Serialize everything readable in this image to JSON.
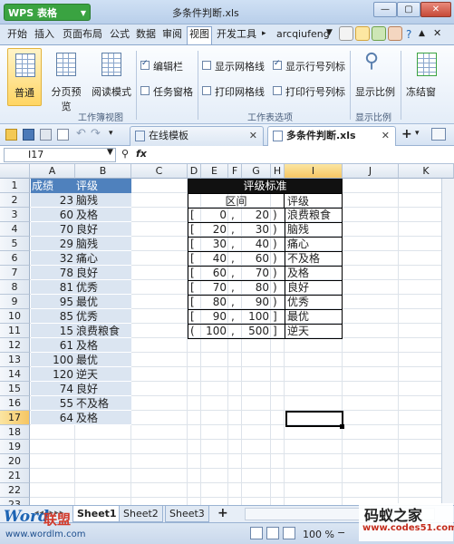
{
  "window": {
    "app_name": "WPS 表格",
    "title": "多条件判断.xls"
  },
  "menu": {
    "tabs": [
      "开始",
      "插入",
      "页面布局",
      "公式",
      "数据",
      "审阅",
      "视图",
      "开发工具"
    ],
    "active_tab": "视图",
    "user": "arcqiufeng"
  },
  "ribbon": {
    "workbook_views": {
      "normal": "普通",
      "page_break_preview": "分页预览",
      "reading_mode": "阅读模式",
      "group_label": "工作簿视图"
    },
    "checkboxes": [
      {
        "label": "编辑栏",
        "checked": true
      },
      {
        "label": "任务窗格",
        "checked": false
      },
      {
        "label": "显示网格线",
        "checked": false
      },
      {
        "label": "打印网格线",
        "checked": false
      },
      {
        "label": "显示行号列标",
        "checked": true
      },
      {
        "label": "打印行号列标",
        "checked": false
      }
    ],
    "sheet_options_label": "工作表选项",
    "zoom_label": "显示比例",
    "zoom_group_label": "显示比例",
    "freeze_label": "冻结窗"
  },
  "doc_tabs": {
    "online_templates": "在线模板",
    "current": "多条件判断.xls"
  },
  "formula_bar": {
    "name_box": "I17",
    "fx": "fx",
    "content": ""
  },
  "grid": {
    "columns": [
      "A",
      "B",
      "C",
      "D",
      "E",
      "F",
      "G",
      "H",
      "I",
      "J",
      "K"
    ],
    "selected_column": "I",
    "rows": [
      "1",
      "2",
      "3",
      "4",
      "5",
      "6",
      "7",
      "8",
      "9",
      "10",
      "11",
      "12",
      "13",
      "14",
      "15",
      "16",
      "17",
      "18",
      "19",
      "20",
      "21",
      "22",
      "23"
    ],
    "selected_row": "17",
    "left_table": {
      "header": [
        "成绩",
        "评级"
      ],
      "rows": [
        [
          "23",
          "脑残"
        ],
        [
          "60",
          "及格"
        ],
        [
          "70",
          "良好"
        ],
        [
          "29",
          "脑残"
        ],
        [
          "32",
          "痛心"
        ],
        [
          "78",
          "良好"
        ],
        [
          "81",
          "优秀"
        ],
        [
          "95",
          "最优"
        ],
        [
          "85",
          "优秀"
        ],
        [
          "15",
          "浪费粮食"
        ],
        [
          "61",
          "及格"
        ],
        [
          "100",
          "最优"
        ],
        [
          "120",
          "逆天"
        ],
        [
          "74",
          "良好"
        ],
        [
          "55",
          "不及格"
        ],
        [
          "64",
          "及格"
        ]
      ]
    },
    "right_table": {
      "title": "评级标准",
      "header_range": "区间",
      "header_grade": "评级",
      "rows": [
        {
          "open": "[",
          "low": "0",
          "sep": ",",
          "high": "20",
          "close": ")",
          "grade": "浪费粮食"
        },
        {
          "open": "[",
          "low": "20",
          "sep": ",",
          "high": "30",
          "close": ")",
          "grade": "脑残"
        },
        {
          "open": "[",
          "low": "30",
          "sep": ",",
          "high": "40",
          "close": ")",
          "grade": "痛心"
        },
        {
          "open": "[",
          "low": "40",
          "sep": ",",
          "high": "60",
          "close": ")",
          "grade": "不及格"
        },
        {
          "open": "[",
          "low": "60",
          "sep": ",",
          "high": "70",
          "close": ")",
          "grade": "及格"
        },
        {
          "open": "[",
          "low": "70",
          "sep": ",",
          "high": "80",
          "close": ")",
          "grade": "良好"
        },
        {
          "open": "[",
          "low": "80",
          "sep": ",",
          "high": "90",
          "close": ")",
          "grade": "优秀"
        },
        {
          "open": "[",
          "low": "90",
          "sep": ",",
          "high": "100",
          "close": "]",
          "grade": "最优"
        },
        {
          "open": "(",
          "low": "100",
          "sep": ",",
          "high": "500",
          "close": "]",
          "grade": "逆天"
        }
      ]
    }
  },
  "sheets": [
    "Sheet1",
    "Sheet2",
    "Sheet3"
  ],
  "active_sheet": "Sheet1",
  "status": {
    "zoom": "100 %"
  },
  "watermarks": {
    "left_word": "Word",
    "left_cn": "联盟",
    "left_url": "www.wordlm.com",
    "right_cn": "码蚁之家",
    "right_url": "www.codes51.com"
  },
  "colors": {
    "header_blue": "#4f81bd",
    "row_blue": "#dbe5f1",
    "selected_header": "#f6c663",
    "wps_green": "#3aa341"
  }
}
